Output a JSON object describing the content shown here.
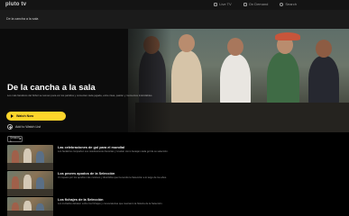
{
  "topbar": {
    "brand": "pluto tv",
    "nav": [
      {
        "icon": "tv-icon",
        "label": "Live TV"
      },
      {
        "icon": "on-demand-icon",
        "label": "On Demand"
      },
      {
        "icon": "search-icon",
        "label": "Search"
      }
    ]
  },
  "breadcrumb": "De la cancha a la sala",
  "hero": {
    "title": "De la cancha a la sala",
    "description": "Los más fanáticos del fútbol se reúnen para ver los partidos y comentar cada jugada, entre risas, pasión y momentos inolvidables.",
    "watch_label": "Watch Now",
    "watchlist_label": "Add to Watch List"
  },
  "season_selector": {
    "label": "Season 1"
  },
  "episodes": [
    {
      "title": "Las celebraciones de gol para el mundial",
      "description": "Los fanáticos comparten sus celebraciones favoritas y revelan cómo festejan cada gol de su selección."
    },
    {
      "title": "Los peores apodos de la Selección",
      "description": "Un repaso por los apodos más curiosos y divertidos que ha tenido la Selección a lo largo de los años."
    },
    {
      "title": "Los fichajes de la Selección",
      "description": "Los invitados debaten sobre los fichajes y convocatorias que marcaron la historia de la Selección."
    }
  ],
  "colors": {
    "accent": "#fdd52b",
    "background": "#000000",
    "topbar": "#141414"
  }
}
